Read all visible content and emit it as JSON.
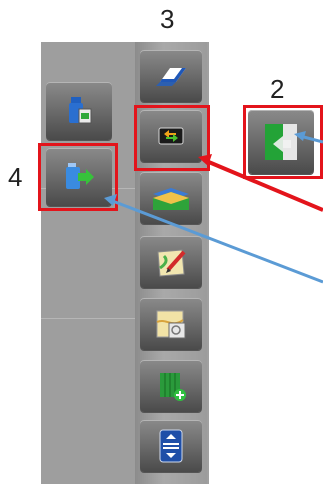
{
  "callouts": {
    "c3": "3",
    "c2": "2",
    "c4": "4"
  },
  "colors": {
    "highlight": "#e3141b",
    "arrow_red": "#e3141b",
    "arrow_blue": "#5b9bd5"
  },
  "tool_column": {
    "buttons": [
      {
        "icon": "eraser-icon"
      },
      {
        "icon": "data-transfer-icon"
      },
      {
        "icon": "field-layers-icon"
      },
      {
        "icon": "map-edit-icon"
      },
      {
        "icon": "map-overlay-icon"
      },
      {
        "icon": "add-field-icon"
      },
      {
        "icon": "scroll-icon"
      }
    ]
  },
  "submenu": {
    "buttons": [
      {
        "icon": "usb-data-icon"
      },
      {
        "icon": "usb-export-icon"
      }
    ]
  },
  "external": {
    "button": {
      "icon": "field-export-icon"
    }
  }
}
